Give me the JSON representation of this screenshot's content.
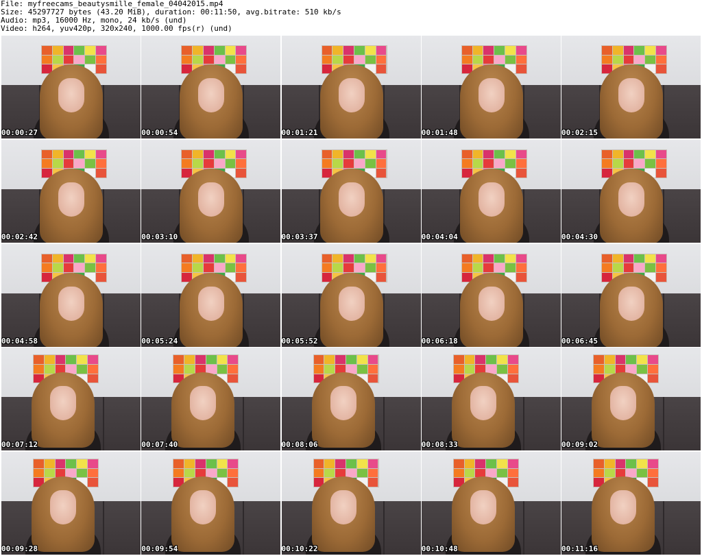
{
  "header": {
    "file": "File: myfreecams_beautysmille_female_04042015.mp4",
    "size": "Size: 45297727 bytes (43.20 MiB), duration: 00:11:50, avg.bitrate: 510 kb/s",
    "audio": "Audio: mp3, 16000 Hz, mono, 24 kb/s (und)",
    "video": "Video: h264, yuv420p, 320x240, 1000.00 fps(r) (und)"
  },
  "thumbnails": [
    {
      "timestamp": "00:00:27"
    },
    {
      "timestamp": "00:00:54"
    },
    {
      "timestamp": "00:01:21"
    },
    {
      "timestamp": "00:01:48"
    },
    {
      "timestamp": "00:02:15"
    },
    {
      "timestamp": "00:02:42"
    },
    {
      "timestamp": "00:03:10"
    },
    {
      "timestamp": "00:03:37"
    },
    {
      "timestamp": "00:04:04"
    },
    {
      "timestamp": "00:04:30"
    },
    {
      "timestamp": "00:04:58"
    },
    {
      "timestamp": "00:05:24"
    },
    {
      "timestamp": "00:05:52"
    },
    {
      "timestamp": "00:06:18"
    },
    {
      "timestamp": "00:06:45"
    },
    {
      "timestamp": "00:07:12"
    },
    {
      "timestamp": "00:07:40"
    },
    {
      "timestamp": "00:08:06"
    },
    {
      "timestamp": "00:08:33"
    },
    {
      "timestamp": "00:09:02"
    },
    {
      "timestamp": "00:09:28"
    },
    {
      "timestamp": "00:09:54"
    },
    {
      "timestamp": "00:10:22"
    },
    {
      "timestamp": "00:10:48"
    },
    {
      "timestamp": "00:11:16"
    }
  ],
  "colors": {
    "art_tiles": [
      "#e8602a",
      "#f0b529",
      "#d9336b",
      "#6cc04a",
      "#f2e24a",
      "#e84a8a",
      "#f47b20",
      "#b8d848",
      "#e63b3b",
      "#f9a8c8",
      "#7ac143",
      "#ff6f3c",
      "#d7263d",
      "#f6c344",
      "#ec5ca0",
      "#3ea84a",
      "#f2f2f2",
      "#e8543a"
    ]
  }
}
